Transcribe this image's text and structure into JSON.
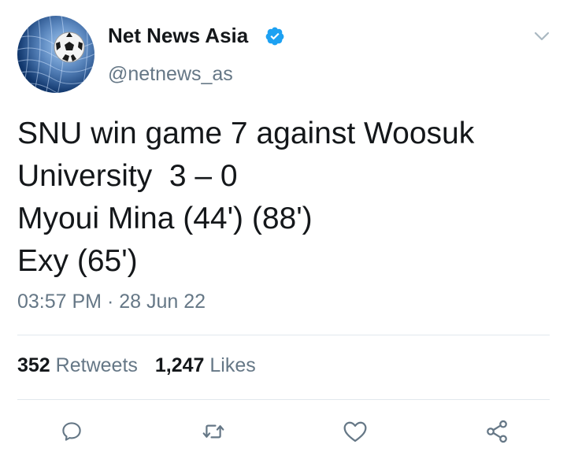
{
  "author": {
    "display_name": "Net News Asia",
    "handle": "@netnews_as",
    "verified": true,
    "avatar_icon": "soccer-ball-in-net-avatar"
  },
  "tweet": {
    "lines": [
      "SNU win game 7 against Woosuk",
      "University  3 – 0",
      "Myoui Mina (44') (88')",
      "Exy (65')"
    ],
    "timestamp": "03:57 PM · 28 Jun 22"
  },
  "stats": {
    "retweets_count": "352",
    "retweets_label": "Retweets",
    "likes_count": "1,247",
    "likes_label": "Likes"
  },
  "actions": {
    "reply_icon": "reply-icon",
    "retweet_icon": "retweet-icon",
    "like_icon": "heart-icon",
    "share_icon": "share-icon"
  },
  "colors": {
    "text_primary": "#14171a",
    "text_secondary": "#657786",
    "verified_blue": "#1da1f2",
    "divider": "#e1e8ed"
  }
}
